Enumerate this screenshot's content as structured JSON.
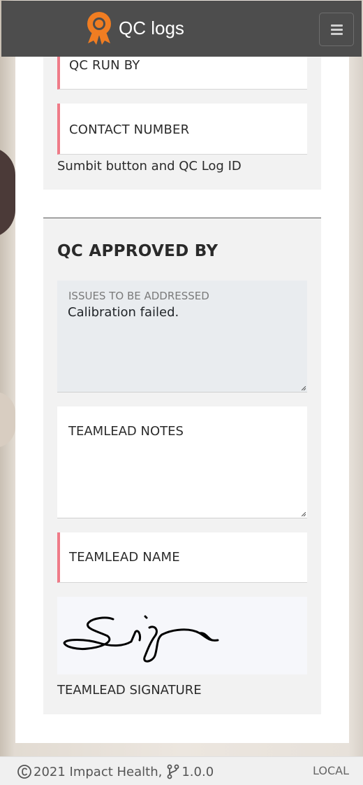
{
  "header": {
    "title": "QC logs",
    "logo_icon": "badge-award-icon",
    "menu_icon": "hamburger-menu-icon",
    "brand_color": "#f07d22"
  },
  "qc_run": {
    "run_by_label": "QC RUN BY",
    "contact_label": "CONTACT NUMBER",
    "note": "Sumbit button and QC Log ID"
  },
  "approval": {
    "title": "QC APPROVED BY",
    "issues_label": "ISSUES TO BE ADDRESSED",
    "issues_value": "Calibration failed.",
    "notes_label": "TEAMLEAD NOTES",
    "name_label": "TEAMLEAD NAME",
    "signature_label": "TEAMLEAD SIGNATURE"
  },
  "footer": {
    "copyright": "2021 Impact Health,",
    "version": "1.0.0",
    "environment": "LOCAL"
  }
}
